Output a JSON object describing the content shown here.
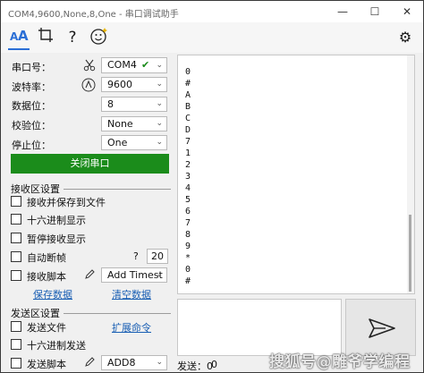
{
  "window": {
    "title": "COM4,9600,None,8,One - 串口调试助手",
    "minimize_glyph": "—",
    "maximize_glyph": "☐",
    "close_glyph": "✕"
  },
  "toolbar": {
    "tools": [
      {
        "name": "font-size-icon",
        "glyph": "A͟A"
      },
      {
        "name": "crop-icon",
        "glyph": "⌗"
      },
      {
        "name": "help-icon",
        "glyph": "?"
      },
      {
        "name": "smiley-icon",
        "glyph": "☺"
      }
    ],
    "settings_glyph": "⚙"
  },
  "serial": {
    "port_label": "串口号：",
    "port_value": "COM4",
    "port_ok_glyph": "✔",
    "baud_label": "波特率：",
    "baud_value": "9600",
    "data_bits_label": "数据位：",
    "data_bits_value": "8",
    "parity_label": "校验位：",
    "parity_value": "None",
    "stop_bits_label": "停止位：",
    "stop_bits_value": "One",
    "close_port_label": "关闭串口"
  },
  "receive_settings": {
    "title": "接收区设置",
    "save_to_file": "接收并保存到文件",
    "hex_display": "十六进制显示",
    "pause_display": "暂停接收显示",
    "auto_break": "自动断帧",
    "auto_break_help": "?",
    "auto_break_value": "20",
    "script": "接收脚本",
    "script_value": "Add Timest",
    "save_data": "保存数据",
    "clear_data": "清空数据"
  },
  "send_settings": {
    "title": "发送区设置",
    "send_file": "发送文件",
    "expand_command": "扩展命令",
    "hex_send": "十六进制发送",
    "script": "发送脚本",
    "script_value": "ADD8"
  },
  "receive_area": {
    "lines": [
      "0",
      "#",
      "A",
      "B",
      "C",
      "D",
      "7",
      "1",
      "2",
      "3",
      "4",
      "5",
      "6",
      "7",
      "8",
      "9",
      "*",
      "0",
      "#"
    ]
  },
  "status_bar": {
    "send_label": "发送：0",
    "second_value": "0"
  },
  "watermark": "搜狐号@雕爷学编程",
  "colors": {
    "accent_green": "#1b8c1b",
    "link_blue": "#1a5fb4",
    "check_green": "#1a8a1a"
  }
}
